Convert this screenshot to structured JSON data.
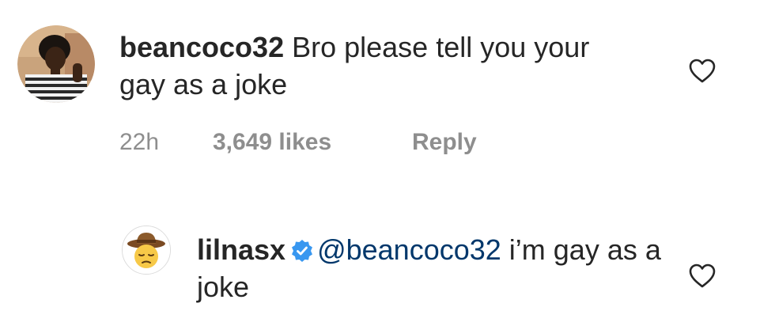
{
  "comments": [
    {
      "username": "beancoco32",
      "text": " Bro please tell you your gay as a joke",
      "avatar_icon": "user-photo-avatar",
      "timestamp": "22h",
      "likes": "3,649 likes",
      "reply_label": "Reply",
      "like_icon": "heart-outline-icon"
    },
    {
      "username": "lilnasx",
      "verified": true,
      "verified_icon": "verified-badge-icon",
      "mention": "@beancoco32",
      "text": " i’m gay as a joke",
      "avatar_icon": "cowboy-emoji-avatar",
      "like_icon": "heart-outline-icon"
    }
  ],
  "colors": {
    "text": "#262626",
    "meta": "#8e8e8e",
    "mention": "#00376b",
    "verified": "#3897f0"
  }
}
